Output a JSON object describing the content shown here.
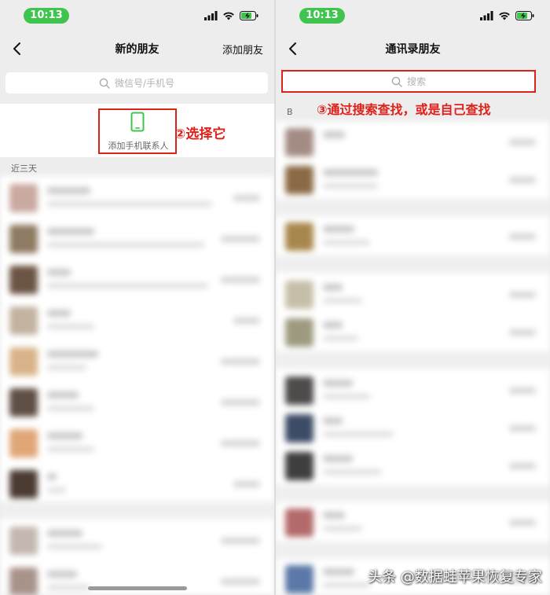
{
  "status": {
    "time": "10:13"
  },
  "left": {
    "nav": {
      "title": "新的朋友",
      "action": "添加朋友"
    },
    "search": {
      "placeholder": "微信号/手机号"
    },
    "add_contact": {
      "label": "添加手机联系人"
    },
    "annotation": "②选择它",
    "section": "近三天"
  },
  "right": {
    "nav": {
      "title": "通讯录朋友"
    },
    "search": {
      "placeholder": "搜索"
    },
    "annotation": "③通过搜索查找，或是自己查找",
    "index_letter": "B"
  },
  "watermark": "头条 @数据蛙苹果恢复专家",
  "colors": {
    "accent_green": "#3fc44e",
    "annotation_red": "#e0201a",
    "background": "#ededed"
  }
}
